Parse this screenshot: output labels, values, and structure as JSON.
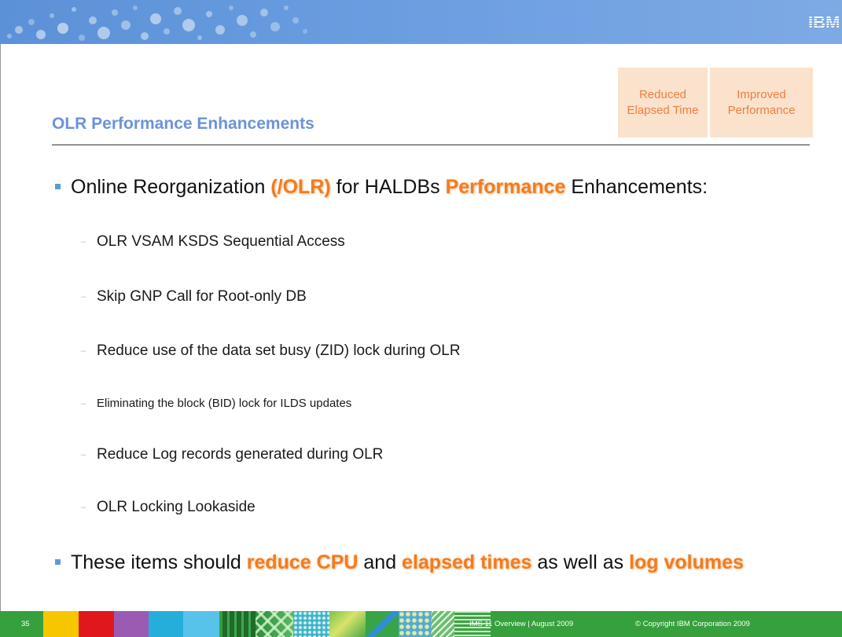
{
  "header": {
    "logo": "IBM"
  },
  "title": "OLR Performance Enhancements",
  "tags": [
    {
      "line1": "Reduced",
      "line2": "Elapsed Time"
    },
    {
      "line1": "Improved",
      "line2": "Performance"
    }
  ],
  "bullet1": {
    "pre": "Online Reorganization ",
    "hl1": "(/OLR)",
    "mid": " for HALDBs ",
    "hl2": "Performance",
    "post": " Enhancements:"
  },
  "sub_items": [
    "OLR VSAM KSDS Sequential Access",
    "Skip GNP Call for Root-only DB",
    "Reduce use of the data set busy (ZID) lock during OLR",
    "Eliminating the block (BID) lock for ILDS updates",
    "Reduce Log records generated during OLR",
    "OLR Locking Lookaside"
  ],
  "sub_dash": "–",
  "bullet2": {
    "pre": "These items should ",
    "hl1": "reduce CPU",
    "mid1": " and ",
    "hl2": "elapsed times",
    "mid2": " as well as ",
    "hl3": "log volumes"
  },
  "footer": {
    "page": "35",
    "title": "IMS 11 Overview | August 2009",
    "copyright": "© Copyright IBM Corporation 2009"
  },
  "colors": {
    "title": "#6b93da",
    "accent": "#f07c22",
    "tag_text": "#ef7f3f",
    "tag_background": "#fbe2cd",
    "bullet": "#5b9bd5",
    "footer": "#36a03c",
    "banner": "#6a9de0"
  }
}
